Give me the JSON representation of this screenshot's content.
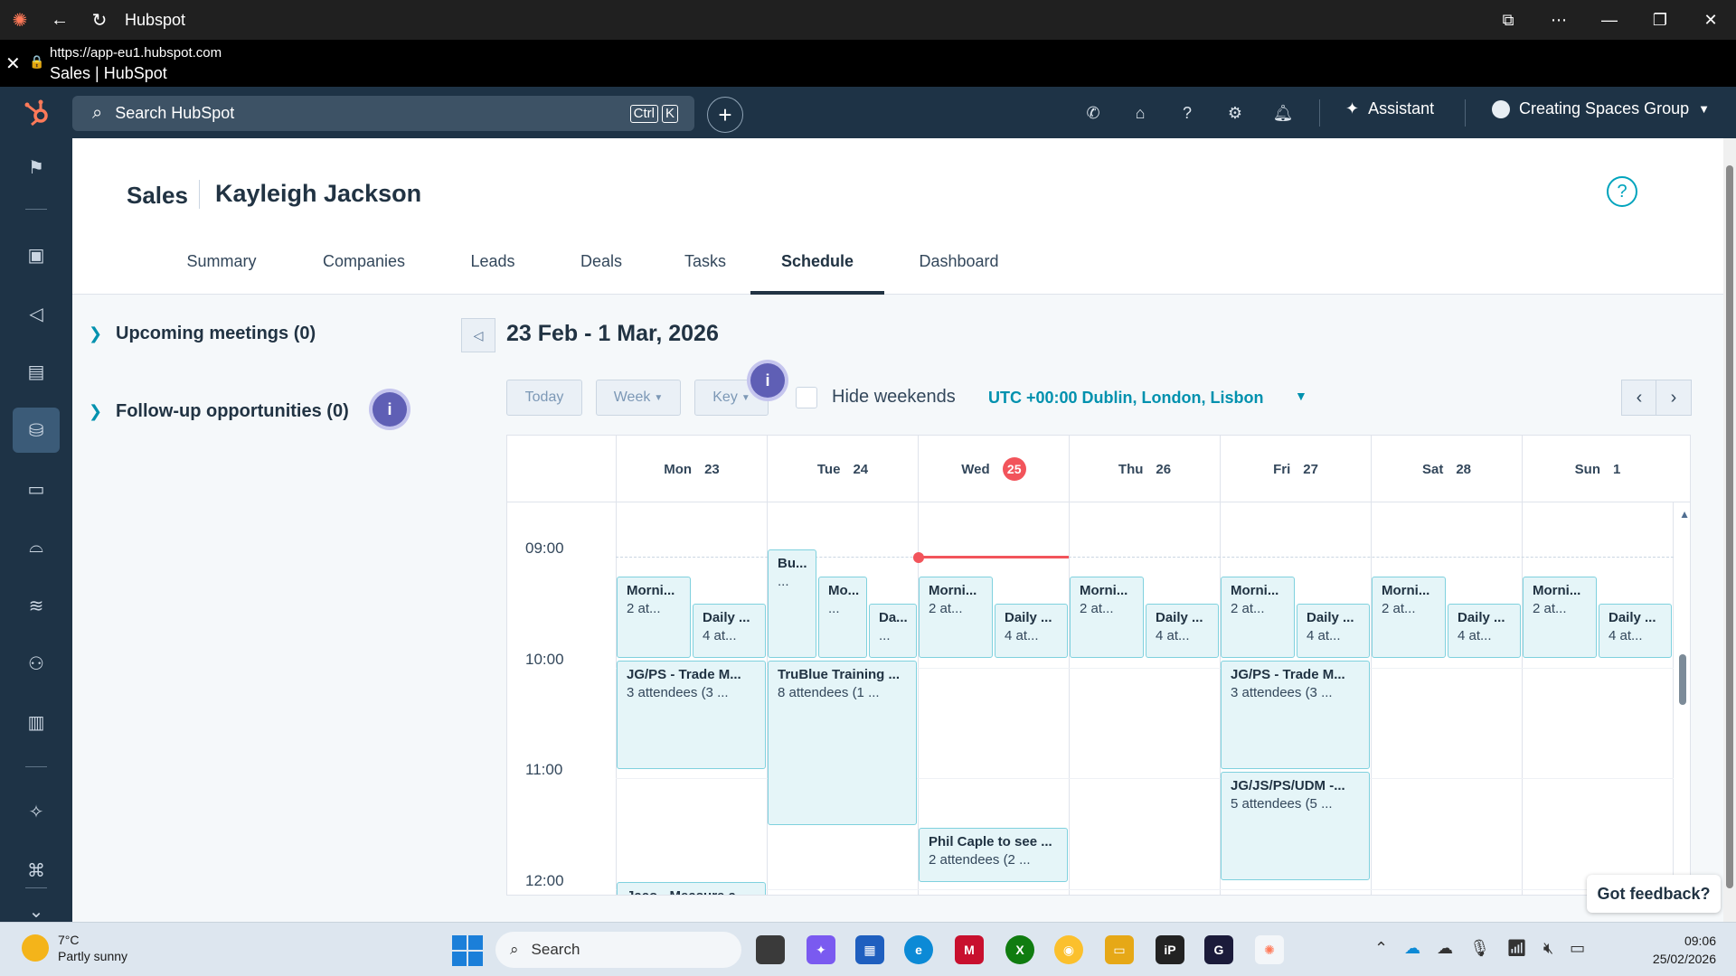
{
  "window": {
    "title": "Hubspot"
  },
  "browser": {
    "url": "https://app-eu1.hubspot.com",
    "page_title": "Sales | HubSpot"
  },
  "topnav": {
    "search_placeholder": "Search HubSpot",
    "shortcut_keys": [
      "Ctrl",
      "K"
    ],
    "assistant_label": "Assistant",
    "account_name": "Creating Spaces Group"
  },
  "header": {
    "app": "Sales",
    "user": "Kayleigh Jackson",
    "tabs": [
      "Summary",
      "Companies",
      "Leads",
      "Deals",
      "Tasks",
      "Schedule",
      "Dashboard"
    ],
    "active_tab": "Schedule"
  },
  "left_panel": {
    "upcoming": "Upcoming meetings (0)",
    "followup": "Follow-up opportunities (0)",
    "info_badge": "i"
  },
  "calendar": {
    "date_range": "23 Feb - 1 Mar, 2026",
    "today_label": "Today",
    "view_label": "Week",
    "key_label": "Key",
    "hide_weekends_label": "Hide weekends",
    "hide_weekends": false,
    "timezone": "UTC +00:00 Dublin, London, Lisbon",
    "days": [
      {
        "name": "Mon",
        "date": "23"
      },
      {
        "name": "Tue",
        "date": "24"
      },
      {
        "name": "Wed",
        "date": "25",
        "today": true
      },
      {
        "name": "Thu",
        "date": "26"
      },
      {
        "name": "Fri",
        "date": "27"
      },
      {
        "name": "Sat",
        "date": "28"
      },
      {
        "name": "Sun",
        "date": "1"
      }
    ],
    "times": [
      "09:00",
      "10:00",
      "11:00",
      "12:00"
    ],
    "events": [
      {
        "title": "Morni...",
        "sub": "2 at..."
      },
      {
        "title": "Daily ...",
        "sub": "4 at..."
      },
      {
        "title": "JG/PS - Trade M...",
        "sub": "3 attendees (3 ..."
      },
      {
        "title": "Jaco - Measure a...",
        "sub": ""
      },
      {
        "title": "Bu...",
        "sub": "..."
      },
      {
        "title": "Mo...",
        "sub": "..."
      },
      {
        "title": "Da...",
        "sub": "..."
      },
      {
        "title": "TruBlue Training ...",
        "sub": "8 attendees (1 ..."
      },
      {
        "title": "Morni...",
        "sub": "2 at..."
      },
      {
        "title": "Daily ...",
        "sub": "4 at..."
      },
      {
        "title": "Phil Caple to see ...",
        "sub": "2 attendees (2 ..."
      },
      {
        "title": "Morni...",
        "sub": "2 at..."
      },
      {
        "title": "Daily ...",
        "sub": "4 at..."
      },
      {
        "title": "Morni...",
        "sub": "2 at..."
      },
      {
        "title": "Daily ...",
        "sub": "4 at..."
      },
      {
        "title": "JG/PS - Trade M...",
        "sub": "3 attendees (3 ..."
      },
      {
        "title": "JG/JS/PS/UDM -...",
        "sub": "5 attendees (5 ..."
      },
      {
        "title": "Morni...",
        "sub": "2 at..."
      },
      {
        "title": "Daily ...",
        "sub": "4 at..."
      },
      {
        "title": "Morni...",
        "sub": "2 at..."
      },
      {
        "title": "Daily ...",
        "sub": "4 at..."
      }
    ]
  },
  "feedback_label": "Got feedback?",
  "taskbar": {
    "temperature": "7°C",
    "weather": "Partly sunny",
    "search_label": "Search",
    "time": "09:06",
    "date": "25/02/2026"
  },
  "colors": {
    "nav_bg": "#1e3346",
    "accent": "#00a4bd",
    "today": "#f2545b",
    "event_bg": "#e5f5f8",
    "event_border": "#7fd1de"
  }
}
